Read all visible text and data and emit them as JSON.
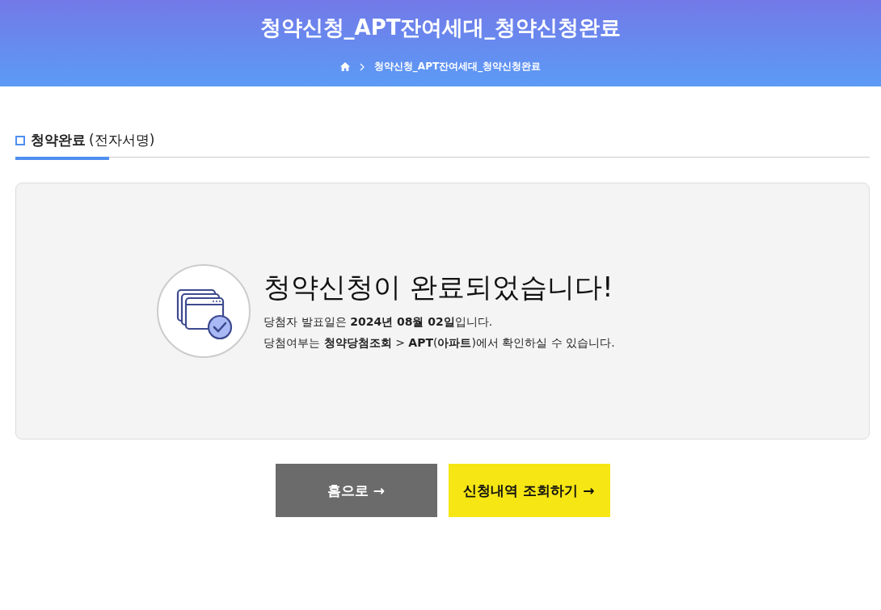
{
  "header": {
    "title": "청약신청_APT잔여세대_청약신청완료",
    "breadcrumb": [
      "청약신청_APT잔여세대_청약신청완료"
    ]
  },
  "section": {
    "title": "청약완료",
    "subtitle": "(전자서명)"
  },
  "result": {
    "heading": "청약신청이 완료되었습니다!",
    "lines": [
      "당첨자 발표일은 **2024년 08월 02일**입니다.",
      "당첨여부는 **청약당첨조회** > **APT**(**아파트**)에서 확인하실 수 있습니다."
    ]
  },
  "buttons": [
    {
      "label": "홈으로 →",
      "kind": "secondary"
    },
    {
      "label": "신청내역 조회하기 →",
      "kind": "primary"
    }
  ]
}
